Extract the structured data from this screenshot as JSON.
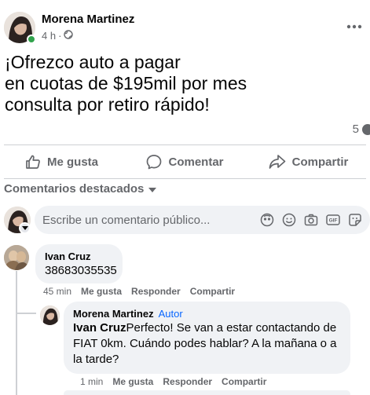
{
  "post": {
    "author": "Morena Martinez",
    "time": "4 h",
    "separator": "·",
    "visibility_icon": "globe-icon",
    "text_lines": [
      "¡Ofrezco auto a pagar",
      "en cuotas de $195mil por mes",
      "consulta por retiro rápido!"
    ],
    "comment_count": "5"
  },
  "actions": {
    "like": "Me gusta",
    "comment": "Comentar",
    "share": "Compartir"
  },
  "comments_filter": {
    "label": "Comentarios destacados"
  },
  "composer": {
    "placeholder": "Escribe un comentario público..."
  },
  "comments": [
    {
      "author": "Ivan Cruz",
      "text": "38683035535",
      "time": "45 min",
      "like_label": "Me gusta",
      "reply_label": "Responder",
      "share_label": "Compartir"
    },
    {
      "author": "Morena Martinez",
      "author_tag": "Autor",
      "mention": "Ivan Cruz",
      "text": "Perfecto! Se van a estar contactando de FIAT 0km. Cuándo podes hablar? A la mañana o a la tarde?",
      "time": "1 min",
      "like_label": "Me gusta",
      "reply_label": "Responder",
      "share_label": "Compartir"
    }
  ],
  "colors": {
    "link_blue": "#0866ff",
    "secondary_text": "#65676b",
    "bubble_bg": "#f0f2f5",
    "online_green": "#31a24c"
  }
}
